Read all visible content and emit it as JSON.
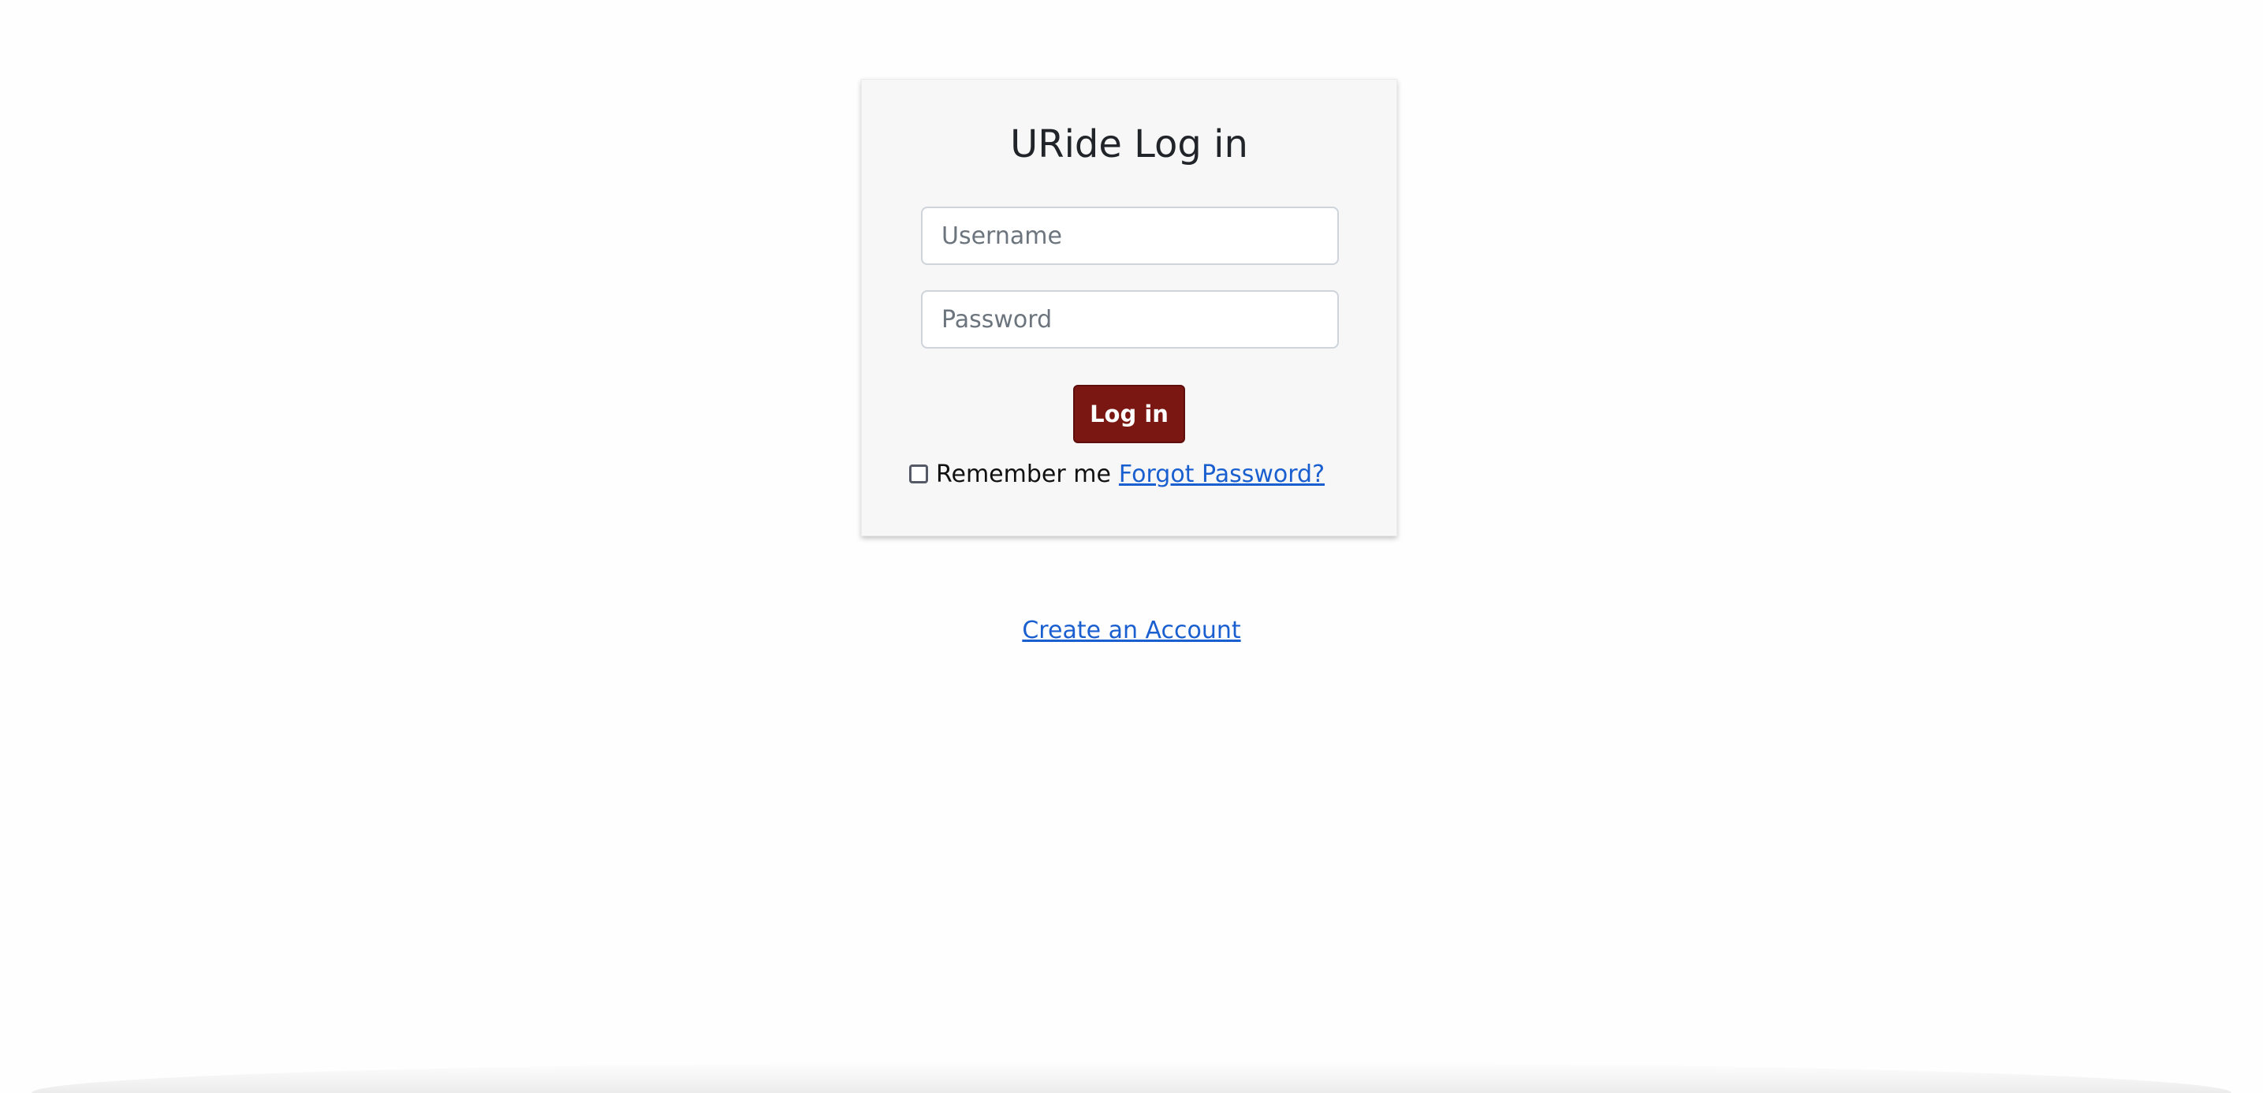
{
  "login": {
    "title": "URide Log in",
    "username_placeholder": "Username",
    "password_placeholder": "Password",
    "submit_label": "Log in",
    "remember_label": "Remember me",
    "forgot_link": "Forgot Password?"
  },
  "footer": {
    "create_account_link": "Create an Account"
  },
  "colors": {
    "button_bg": "#7a1712",
    "link": "#1a5fd0",
    "card_bg": "#f7f7f7"
  }
}
